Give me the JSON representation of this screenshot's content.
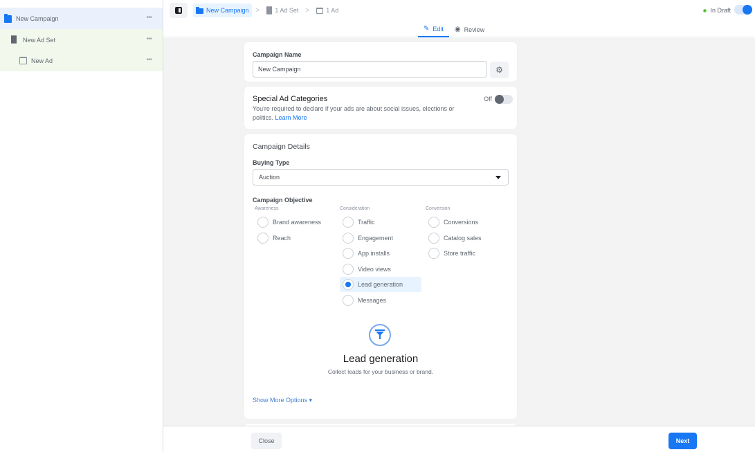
{
  "sidebar": {
    "items": [
      {
        "label": "New Campaign",
        "icon": "folder-icon",
        "more": "•••"
      },
      {
        "label": "New Ad Set",
        "icon": "grid-icon",
        "more": "•••"
      },
      {
        "label": "New Ad",
        "icon": "ad-icon",
        "more": "•••"
      }
    ]
  },
  "header": {
    "breadcrumbs": [
      {
        "label": "New Campaign",
        "icon": "folder-icon"
      },
      {
        "label": "1 Ad Set",
        "icon": "grid-icon"
      },
      {
        "label": "1 Ad",
        "icon": "ad-icon"
      }
    ],
    "separator": ">",
    "tabs": [
      {
        "label": "Edit",
        "icon": "✎",
        "active": true
      },
      {
        "label": "Review",
        "icon": "◉",
        "active": false
      }
    ],
    "status": "In Draft",
    "status_color": "#42b72a",
    "draft_toggle_on": true
  },
  "campaign_name": {
    "label": "Campaign Name",
    "value": "New Campaign",
    "settings_icon": "⚙"
  },
  "special_ad_categories": {
    "title": "Special Ad Categories",
    "description": "You're required to declare if your ads are about social issues, elections or politics.",
    "link": "Learn More",
    "toggle_label": "Off",
    "toggle_on": false
  },
  "campaign_details": {
    "title": "Campaign Details",
    "buying_type_label": "Buying Type",
    "buying_type_value": "Auction",
    "objective_label": "Campaign Objective",
    "columns": [
      {
        "heading": "Awareness",
        "options": [
          "Brand awareness",
          "Reach"
        ]
      },
      {
        "heading": "Consideration",
        "options": [
          "Traffic",
          "Engagement",
          "App installs",
          "Video views",
          "Lead generation",
          "Messages"
        ]
      },
      {
        "heading": "Conversion",
        "options": [
          "Conversions",
          "Catalog sales",
          "Store traffic"
        ]
      }
    ],
    "selected_objective": "Lead generation",
    "objective_detail": {
      "icon": "funnel-icon",
      "title": "Lead generation",
      "description": "Collect leads for your business or brand."
    },
    "show_more": "Show More Options ▾"
  },
  "footer": {
    "close_label": "Close",
    "next_label": "Next"
  },
  "colors": {
    "accent": "#1877f2"
  }
}
